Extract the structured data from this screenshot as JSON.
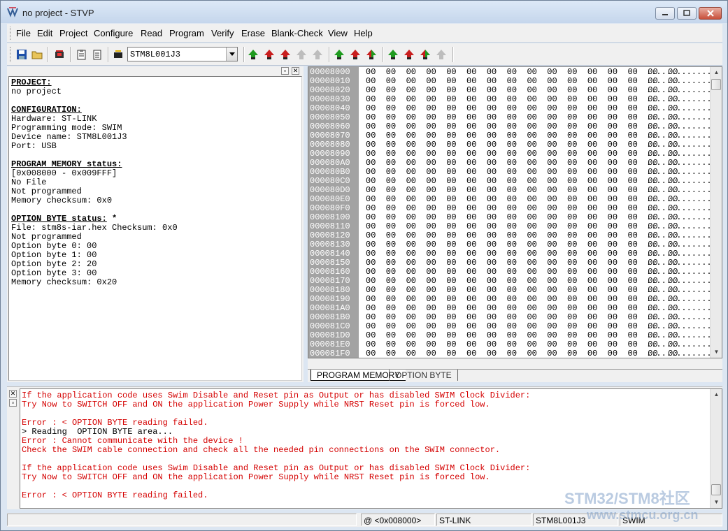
{
  "window": {
    "title": "no project - STVP"
  },
  "menu": [
    "File",
    "Edit",
    "Project",
    "Configure",
    "Read",
    "Program",
    "Verify",
    "Erase",
    "Blank-Check",
    "View",
    "Help"
  ],
  "toolbar": {
    "device": "STM8L001J3"
  },
  "project_info": {
    "sections": [
      {
        "heading": "PROJECT:",
        "suffix": "",
        "lines": [
          "no project"
        ]
      },
      {
        "heading": "CONFIGURATION:",
        "suffix": "",
        "lines": [
          "Hardware: ST-LINK",
          "Programming mode: SWIM",
          "Device name: STM8L001J3",
          "Port: USB"
        ]
      },
      {
        "heading": "PROGRAM MEMORY status:",
        "suffix": "",
        "lines": [
          "[0x008000 - 0x009FFF]",
          "No File",
          "Not programmed",
          "Memory checksum: 0x0"
        ]
      },
      {
        "heading": "OPTION BYTE status:",
        "suffix": " *",
        "lines": [
          "File: stm8s-iar.hex Checksum: 0x0",
          "Not programmed",
          "Option byte 0: 00",
          "Option byte 1: 00",
          "Option byte 2: 20",
          "Option byte 3: 00",
          "Memory checksum: 0x20"
        ]
      }
    ]
  },
  "memory": {
    "addresses": [
      "00008000",
      "00008010",
      "00008020",
      "00008030",
      "00008040",
      "00008050",
      "00008060",
      "00008070",
      "00008080",
      "00008090",
      "000080A0",
      "000080B0",
      "000080C0",
      "000080D0",
      "000080E0",
      "000080F0",
      "00008100",
      "00008110",
      "00008120",
      "00008130",
      "00008140",
      "00008150",
      "00008160",
      "00008170",
      "00008180",
      "00008190",
      "000081A0",
      "000081B0",
      "000081C0",
      "000081D0",
      "000081E0",
      "000081F0"
    ],
    "bytes": "00  00  00  00  00  00  00  00  00  00  00  00  00  00  00  00",
    "ascii": "................",
    "tabs": [
      "PROGRAM MEMORY",
      "OPTION BYTE"
    ]
  },
  "log": [
    {
      "text": "If the application code uses Swim Disable and Reset pin as Output or has disabled SWIM Clock Divider:",
      "type": "err"
    },
    {
      "text": "Try Now to SWITCH OFF and ON the application Power Supply while NRST Reset pin is forced low.",
      "type": "err"
    },
    {
      "text": "",
      "type": "err"
    },
    {
      "text": "Error : < OPTION BYTE reading failed.",
      "type": "err"
    },
    {
      "text": "> Reading  OPTION BYTE area...",
      "type": "info"
    },
    {
      "text": "Error : Cannot communicate with the device !",
      "type": "err"
    },
    {
      "text": "Check the SWIM cable connection and check all the needed pin connections on the SWIM connector.",
      "type": "err"
    },
    {
      "text": "",
      "type": "err"
    },
    {
      "text": "If the application code uses Swim Disable and Reset pin as Output or has disabled SWIM Clock Divider:",
      "type": "err"
    },
    {
      "text": "Try Now to SWITCH OFF and ON the application Power Supply while NRST Reset pin is forced low.",
      "type": "err"
    },
    {
      "text": "",
      "type": "err"
    },
    {
      "text": "Error : < OPTION BYTE reading failed.",
      "type": "err"
    }
  ],
  "status": {
    "address": "@ <0x008000>",
    "hardware": "ST-LINK",
    "device": "STM8L001J3",
    "mode": "SWIM"
  },
  "watermark": {
    "line1": "STM32/STM8社区",
    "line2": "www.stmcu.org.cn"
  },
  "colors": {
    "error_text": "#d40000",
    "address_column": "#a3a3a3",
    "arrow_green": "#1f9a1f",
    "arrow_red": "#c81e1e"
  }
}
